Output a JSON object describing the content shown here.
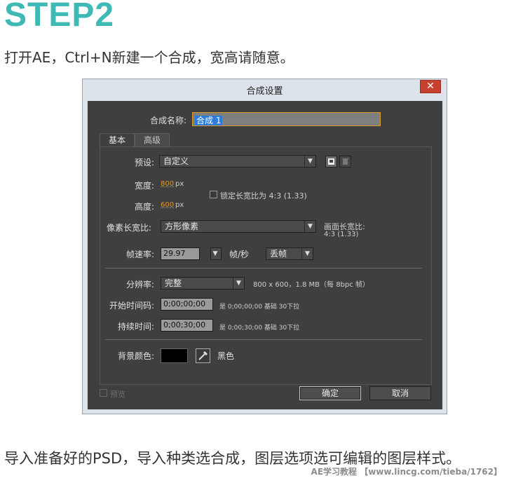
{
  "article": {
    "heading": "STEP2",
    "intro": "打开AE，Ctrl+N新建一个合成，宽高请随意。",
    "outro": "导入准备好的PSD，导入种类选合成，图层选项选可编辑的图层样式。",
    "watermark": "AE学习教程 【www.lincg.com/tieba/1762】"
  },
  "dialog": {
    "title": "合成设置",
    "close": "✕",
    "comp_name_label": "合成名称:",
    "comp_name_value": "合成 1",
    "tabs": [
      {
        "label": "基本"
      },
      {
        "label": "高级"
      }
    ],
    "preset_label": "预设:",
    "preset_value": "自定义",
    "width_label": "宽度:",
    "width_value": "800",
    "height_label": "高度:",
    "height_value": "600",
    "unit_px": "px",
    "lock_aspect_label": "锁定长宽比为 4:3 (1.33)",
    "pixel_aspect_label": "像素长宽比:",
    "pixel_aspect_value": "方形像素",
    "frame_aspect_label": "画面长宽比:",
    "frame_aspect_value": "4:3 (1.33)",
    "fps_label": "帧速率:",
    "fps_value": "29.97",
    "fps_unit": "帧/秒",
    "drop_frame_value": "丢帧",
    "resolution_label": "分辨率:",
    "resolution_value": "完整",
    "resolution_info": "800 x 600，1.8 MB（每 8bpc 帧）",
    "start_tc_label": "开始时间码:",
    "start_tc_value": "0;00;00;00",
    "start_tc_info": "是 0;00;00;00  基础 30下拉",
    "duration_label": "持续时间:",
    "duration_value": "0;00;30;00",
    "duration_info": "是 0;00;30;00  基础 30下拉",
    "bg_color_label": "背景颜色:",
    "bg_color_name": "黑色",
    "bg_color_hex": "#000000",
    "preview_label": "预览",
    "ok_label": "确定",
    "cancel_label": "取消"
  },
  "colors": {
    "heading": "#3fb9b5",
    "value_highlight": "#e09a2d",
    "selection": "#2f7bd9",
    "close_button": "#c8402f"
  }
}
